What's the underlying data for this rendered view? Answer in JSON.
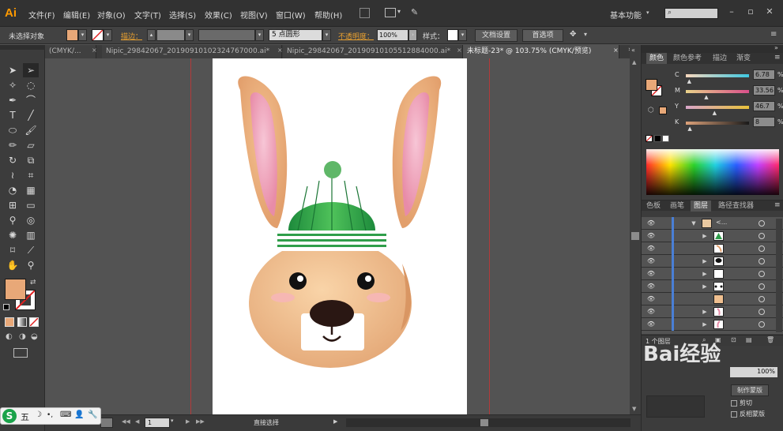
{
  "app": {
    "logo": "Ai"
  },
  "menu": [
    {
      "label": "文件(F)"
    },
    {
      "label": "编辑(E)"
    },
    {
      "label": "对象(O)"
    },
    {
      "label": "文字(T)"
    },
    {
      "label": "选择(S)"
    },
    {
      "label": "效果(C)"
    },
    {
      "label": "视图(V)"
    },
    {
      "label": "窗口(W)"
    },
    {
      "label": "帮助(H)"
    }
  ],
  "workspace": {
    "label": "基本功能"
  },
  "control": {
    "selection_status": "未选择对象",
    "stroke_label": "描边：",
    "brush_label": "5 点圆形",
    "opacity_label": "不透明度：",
    "opacity_value": "100%",
    "style_label": "样式：",
    "doc_setup": "文档设置",
    "preferences": "首选项"
  },
  "tabs": [
    {
      "label": "(CMYK/..."
    },
    {
      "label": "Nipic_29842067_20190910102324767000.ai*"
    },
    {
      "label": "Nipic_29842067_20190910105512884000.ai*"
    },
    {
      "label": "未标题-23* @ 103.75% (CMYK/预览)"
    }
  ],
  "color_panel": {
    "tabs": [
      "颜色",
      "颜色参考",
      "描边",
      "渐变"
    ],
    "channels": [
      {
        "name": "C",
        "value": "6.78",
        "fraction": 0.07,
        "gradient": "linear-gradient(90deg,#f9d8bd,#3ec7e0)"
      },
      {
        "name": "M",
        "value": "33.56",
        "fraction": 0.34,
        "gradient": "linear-gradient(90deg,#e9d38a,#d94f8a)"
      },
      {
        "name": "Y",
        "value": "46.7",
        "fraction": 0.47,
        "gradient": "linear-gradient(90deg,#d8a6c9,#e8c23a)"
      },
      {
        "name": "K",
        "value": "8",
        "fraction": 0.08,
        "gradient": "linear-gradient(90deg,#dda27a,#1a1a1a)"
      }
    ]
  },
  "layers_panel": {
    "tabs": [
      "色板",
      "画笔",
      "图层",
      "路径查找器"
    ],
    "top_row_label": "<...",
    "footer_count": "1 个图层"
  },
  "status": {
    "tool_name": "直接选择",
    "zoom": "1"
  },
  "watermark": "Bai经验",
  "bottom_panel": {
    "make_mask": "制作蒙版",
    "clip": "剪切",
    "invert_mask": "反相蒙版"
  },
  "colors": {
    "fill": "#e8a878",
    "accent_orange": "#ff9a00",
    "layer_highlight": "#4a7fd6"
  }
}
